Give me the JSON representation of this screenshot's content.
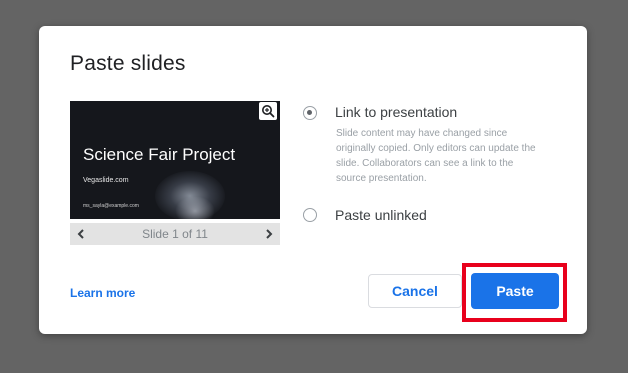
{
  "dialog": {
    "title": "Paste slides"
  },
  "preview": {
    "slide_title": "Science Fair Project",
    "slide_subtitle": "Vegaslide.com",
    "slide_url": "ms_sayla@example.com",
    "zoom_icon": "zoom-in-icon",
    "counter": "Slide 1 of 11",
    "prev_icon": "chevron-left-icon",
    "next_icon": "chevron-right-icon"
  },
  "options": {
    "link": {
      "label": "Link to presentation",
      "description": "Slide content may have changed since originally copied. Only editors can update the slide. Collaborators can see a link to the source presentation.",
      "checked": true
    },
    "unlinked": {
      "label": "Paste unlinked",
      "checked": false
    }
  },
  "footer": {
    "learn_more": "Learn more",
    "cancel": "Cancel",
    "paste": "Paste"
  },
  "colors": {
    "backdrop": "#646464",
    "accent": "#1a73e8",
    "highlight": "#e8001c"
  }
}
